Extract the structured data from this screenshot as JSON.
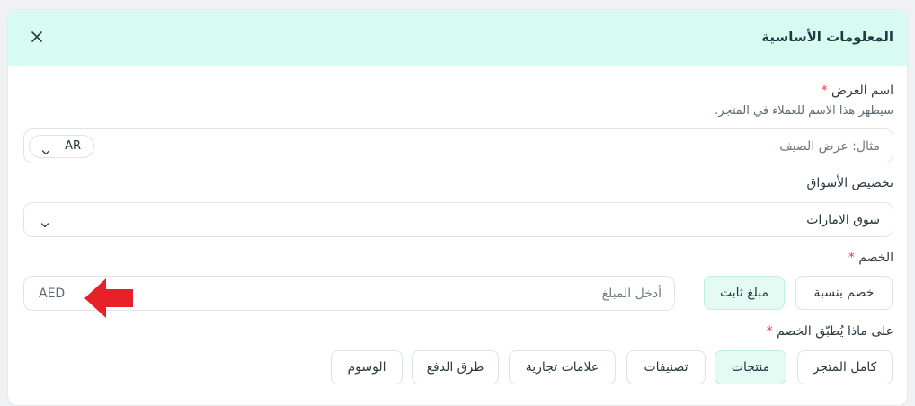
{
  "header": {
    "title": "المعلومات الأساسية",
    "close_icon": "close-icon"
  },
  "offer_name": {
    "label": "اسم العرض",
    "required_mark": "*",
    "hint": "سيظهر هذا الاسم للعملاء في المتجر.",
    "placeholder": "مثال: عرض الصيف",
    "language": "AR"
  },
  "markets": {
    "label": "تخصيص الأسواق",
    "selected": "سوق الامارات"
  },
  "discount": {
    "label": "الخصم",
    "required_mark": "*",
    "types": [
      "خصم بنسبة",
      "مبلغ ثابت"
    ],
    "active_type_index": 1,
    "amount_placeholder": "أدخل المبلغ",
    "currency": "AED"
  },
  "apply_to": {
    "label": "على ماذا يُطبّق الخصم",
    "required_mark": "*",
    "options": [
      "كامل المتجر",
      "منتجات",
      "تصنيفات",
      "علامات تجارية",
      "طرق الدفع",
      "الوسوم"
    ],
    "active_option_index": 1
  },
  "annotation": {
    "arrow_color": "#e8202a"
  },
  "colors": {
    "header_bg": "#d8fbf1",
    "active_bg": "#e4fbf4",
    "required": "#e0434e"
  }
}
